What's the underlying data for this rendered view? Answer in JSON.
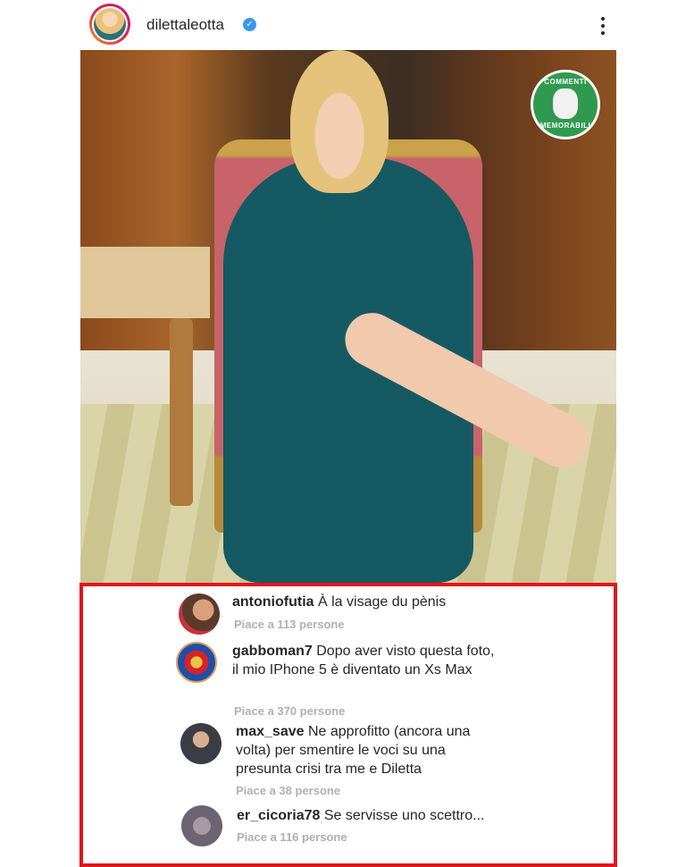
{
  "post": {
    "username": "dilettaleotta",
    "verified_icon": "verified-badge-icon",
    "more_icon": "more-vertical-icon"
  },
  "badge": {
    "top_text": "COMMENTI",
    "bottom_text": "MEMORABILI"
  },
  "comments": [
    {
      "user": "antoniofutia",
      "text": "À la visage du pènis",
      "likes": "Piace a 113 persone"
    },
    {
      "user": "gabboman7",
      "text": "Dopo aver visto questa foto, il mio IPhone 5 è diventato un Xs Max",
      "likes": "Piace a 370 persone"
    },
    {
      "user": "max_save",
      "text": "Ne approfitto (ancora una volta) per smentire le voci su una presunta crisi tra me e Diletta",
      "likes": "Piace a 38 persone"
    },
    {
      "user": "er_cicoria78",
      "text": "Se servisse uno scettro...",
      "likes": "Piace a 116 persone"
    }
  ],
  "colors": {
    "highlight_border": "#e0161d",
    "verified": "#3897f0",
    "likes_text": "#b0b0b0"
  }
}
